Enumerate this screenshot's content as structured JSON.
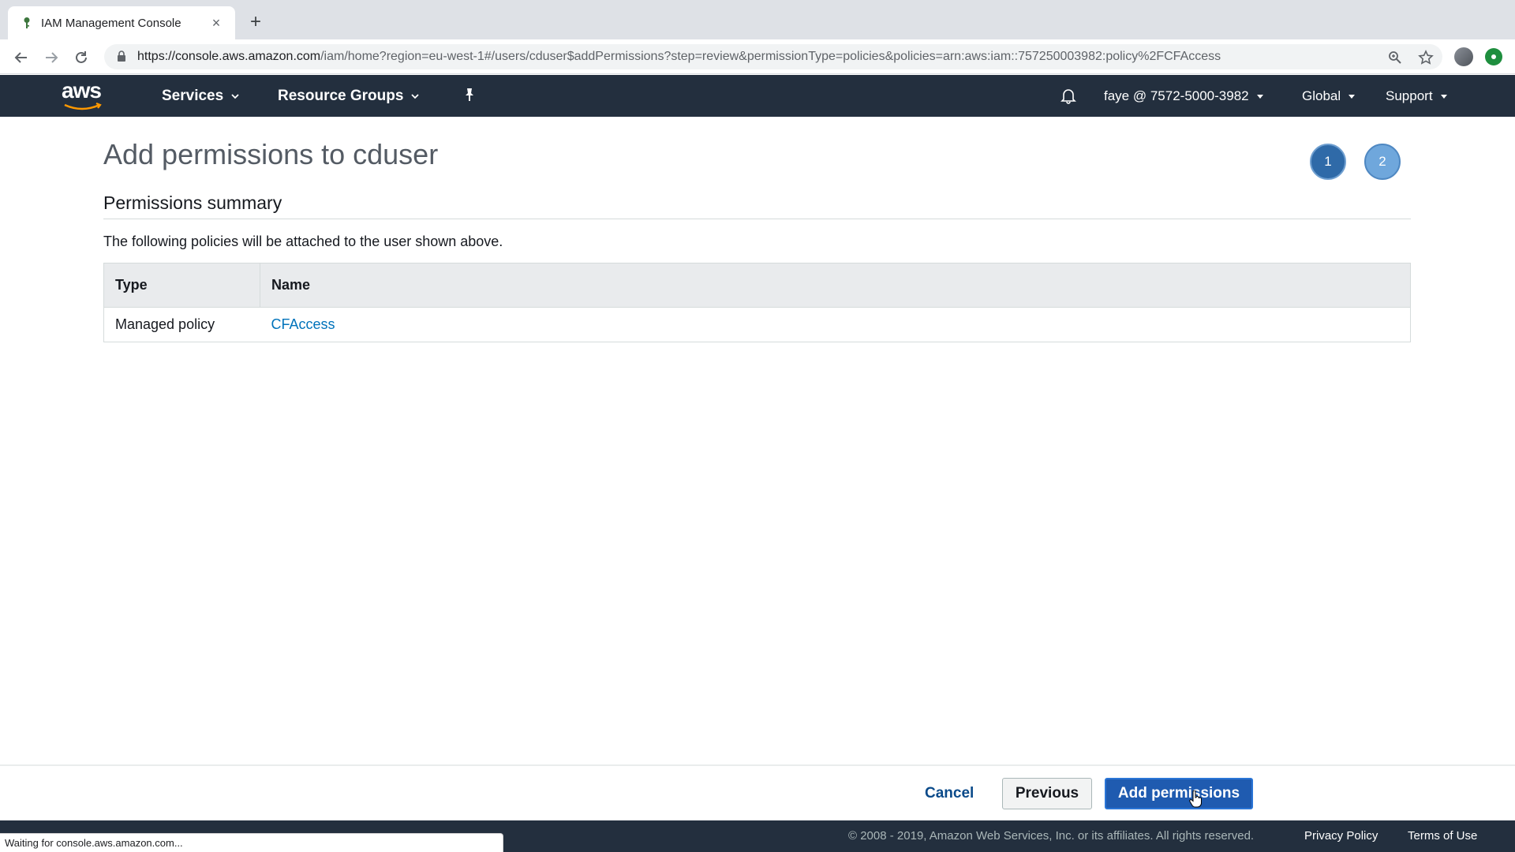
{
  "browser": {
    "tab_title": "IAM Management Console",
    "url_host": "https://console.aws.amazon.com",
    "url_path": "/iam/home?region=eu-west-1#/users/cduser$addPermissions?step=review&permissionType=policies&policies=arn:aws:iam::757250003982:policy%2FCFAccess",
    "status_text": "Waiting for console.aws.amazon.com..."
  },
  "aws_nav": {
    "logo": "aws",
    "services_label": "Services",
    "resource_groups_label": "Resource Groups",
    "account_label": "faye @ 7572-5000-3982",
    "region_label": "Global",
    "support_label": "Support"
  },
  "main": {
    "page_title": "Add permissions to cduser",
    "steps": [
      "1",
      "2"
    ],
    "section_title": "Permissions summary",
    "description": "The following policies will be attached to the user shown above.",
    "table": {
      "headers": [
        "Type",
        "Name"
      ],
      "rows": [
        {
          "type": "Managed policy",
          "name": "CFAccess"
        }
      ]
    }
  },
  "actions": {
    "cancel_label": "Cancel",
    "previous_label": "Previous",
    "add_label": "Add permissions"
  },
  "footer": {
    "copyright": "© 2008 - 2019, Amazon Web Services, Inc. or its affiliates. All rights reserved.",
    "privacy_label": "Privacy Policy",
    "terms_label": "Terms of Use"
  },
  "colors": {
    "aws_nav_bg": "#232f3e",
    "primary_button": "#1f5bb0",
    "link": "#0073bb"
  }
}
